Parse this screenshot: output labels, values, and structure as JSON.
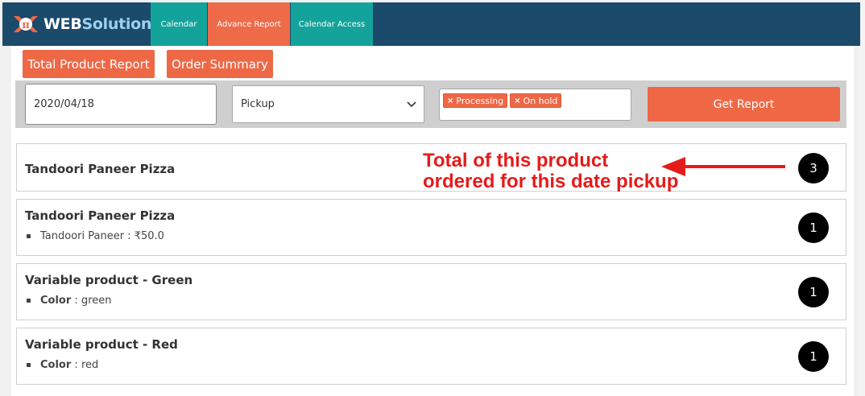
{
  "brand": {
    "prefix": "WEB",
    "suffix": "Solution",
    "mark": "π"
  },
  "nav": {
    "tabs": [
      {
        "label": "Calendar"
      },
      {
        "label": "Advance Report"
      },
      {
        "label": "Calendar Access"
      }
    ],
    "active": "Advance Report"
  },
  "toolbar": {
    "total_product_report": "Total Product Report",
    "order_summary": "Order Summary"
  },
  "filters": {
    "date_value": "2020/04/18",
    "delivery_type": "Pickup",
    "statuses": [
      {
        "label": "Processing"
      },
      {
        "label": "On hold"
      }
    ],
    "tag_remove_symbol": "×",
    "get_report_label": "Get Report"
  },
  "results": [
    {
      "title": "Tandoori Paneer Pizza",
      "count": "3"
    },
    {
      "title": "Tandoori Paneer Pizza",
      "meta_key": "Tandoori Paneer",
      "meta_sep": " : ",
      "meta_value": "₹50.0",
      "count": "1"
    },
    {
      "title": "Variable product - Green",
      "meta_key": "Color",
      "meta_sep": " : ",
      "meta_value": "green",
      "count": "1"
    },
    {
      "title": "Variable product - Red",
      "meta_key": "Color",
      "meta_sep": " : ",
      "meta_value": "red",
      "count": "1"
    }
  ],
  "annotation": {
    "line1": "Total of this product",
    "line2": "ordered for this date pickup"
  },
  "colors": {
    "nav_bg": "#1b4a6b",
    "teal": "#14a39a",
    "accent": "#ef6846",
    "annotation": "#e51b1b"
  }
}
